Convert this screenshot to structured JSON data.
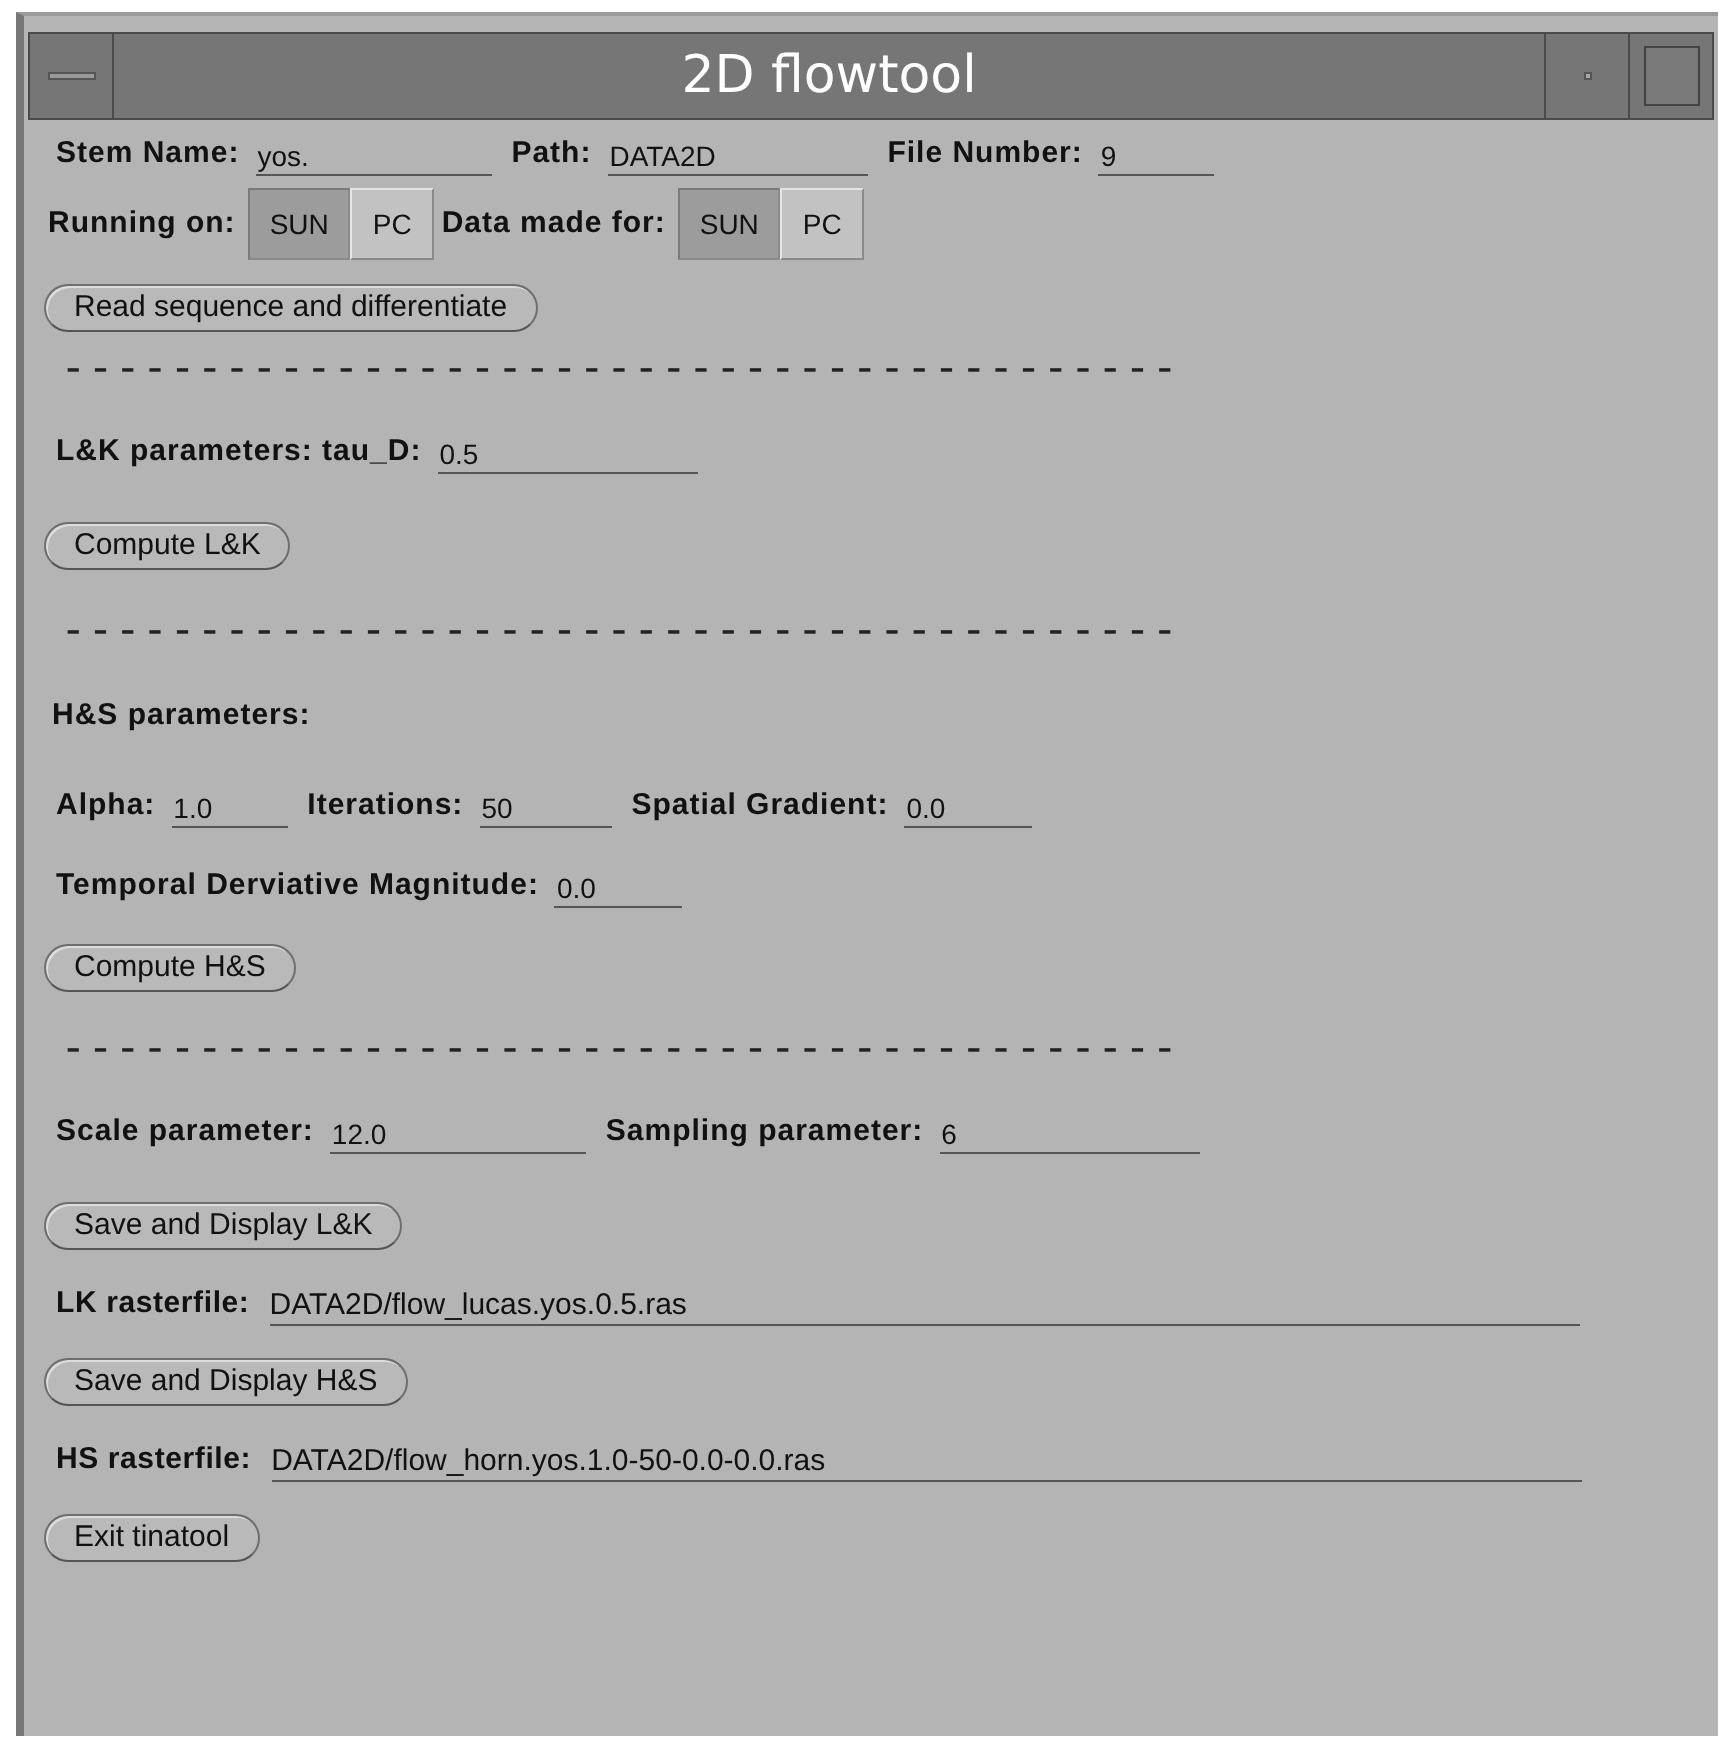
{
  "window": {
    "title": "2D flowtool"
  },
  "rows": [
    {
      "kind": "fields",
      "fields": [
        {
          "label": "Stem Name:",
          "value": "yos."
        },
        {
          "label": "Path:",
          "value": "DATA2D"
        },
        {
          "label": "File Number:",
          "value": "9"
        }
      ]
    },
    {
      "kind": "toggles",
      "groups": [
        {
          "label": "Running on:",
          "options": [
            {
              "label": "SUN",
              "selected": true
            },
            {
              "label": "PC",
              "selected": false
            }
          ]
        },
        {
          "label": "Data made for:",
          "options": [
            {
              "label": "SUN",
              "selected": true
            },
            {
              "label": "PC",
              "selected": false
            }
          ]
        }
      ]
    },
    {
      "kind": "button",
      "label": "Read sequence and differentiate"
    },
    {
      "kind": "separator",
      "text": "-----------------------------------------"
    },
    {
      "kind": "fields",
      "fields": [
        {
          "label": "L&K parameters: tau_D:",
          "value": "0.5"
        }
      ]
    },
    {
      "kind": "button",
      "label": "Compute L&K"
    },
    {
      "kind": "separator",
      "text": "-----------------------------------------"
    },
    {
      "kind": "heading",
      "text": "H&S parameters:"
    },
    {
      "kind": "fields",
      "fields": [
        {
          "label": "Alpha:",
          "value": "1.0"
        },
        {
          "label": "Iterations:",
          "value": "50"
        },
        {
          "label": "Spatial Gradient:",
          "value": "0.0"
        }
      ]
    },
    {
      "kind": "fields",
      "fields": [
        {
          "label": "Temporal Derviative Magnitude:",
          "value": "0.0"
        }
      ]
    },
    {
      "kind": "button",
      "label": "Compute H&S"
    },
    {
      "kind": "separator",
      "text": "-----------------------------------------"
    },
    {
      "kind": "fields",
      "fields": [
        {
          "label": "Scale parameter:",
          "value": "12.0"
        },
        {
          "label": "Sampling parameter:",
          "value": "6"
        }
      ]
    },
    {
      "kind": "button",
      "label": "Save and Display L&K"
    },
    {
      "kind": "file",
      "label": "LK rasterfile:",
      "value": "DATA2D/flow_lucas.yos.0.5.ras"
    },
    {
      "kind": "button",
      "label": "Save and Display H&S"
    },
    {
      "kind": "file",
      "label": "HS rasterfile:",
      "value": "DATA2D/flow_horn.yos.1.0-50-0.0-0.0.ras"
    },
    {
      "kind": "button",
      "label": "Exit tinatool"
    }
  ]
}
